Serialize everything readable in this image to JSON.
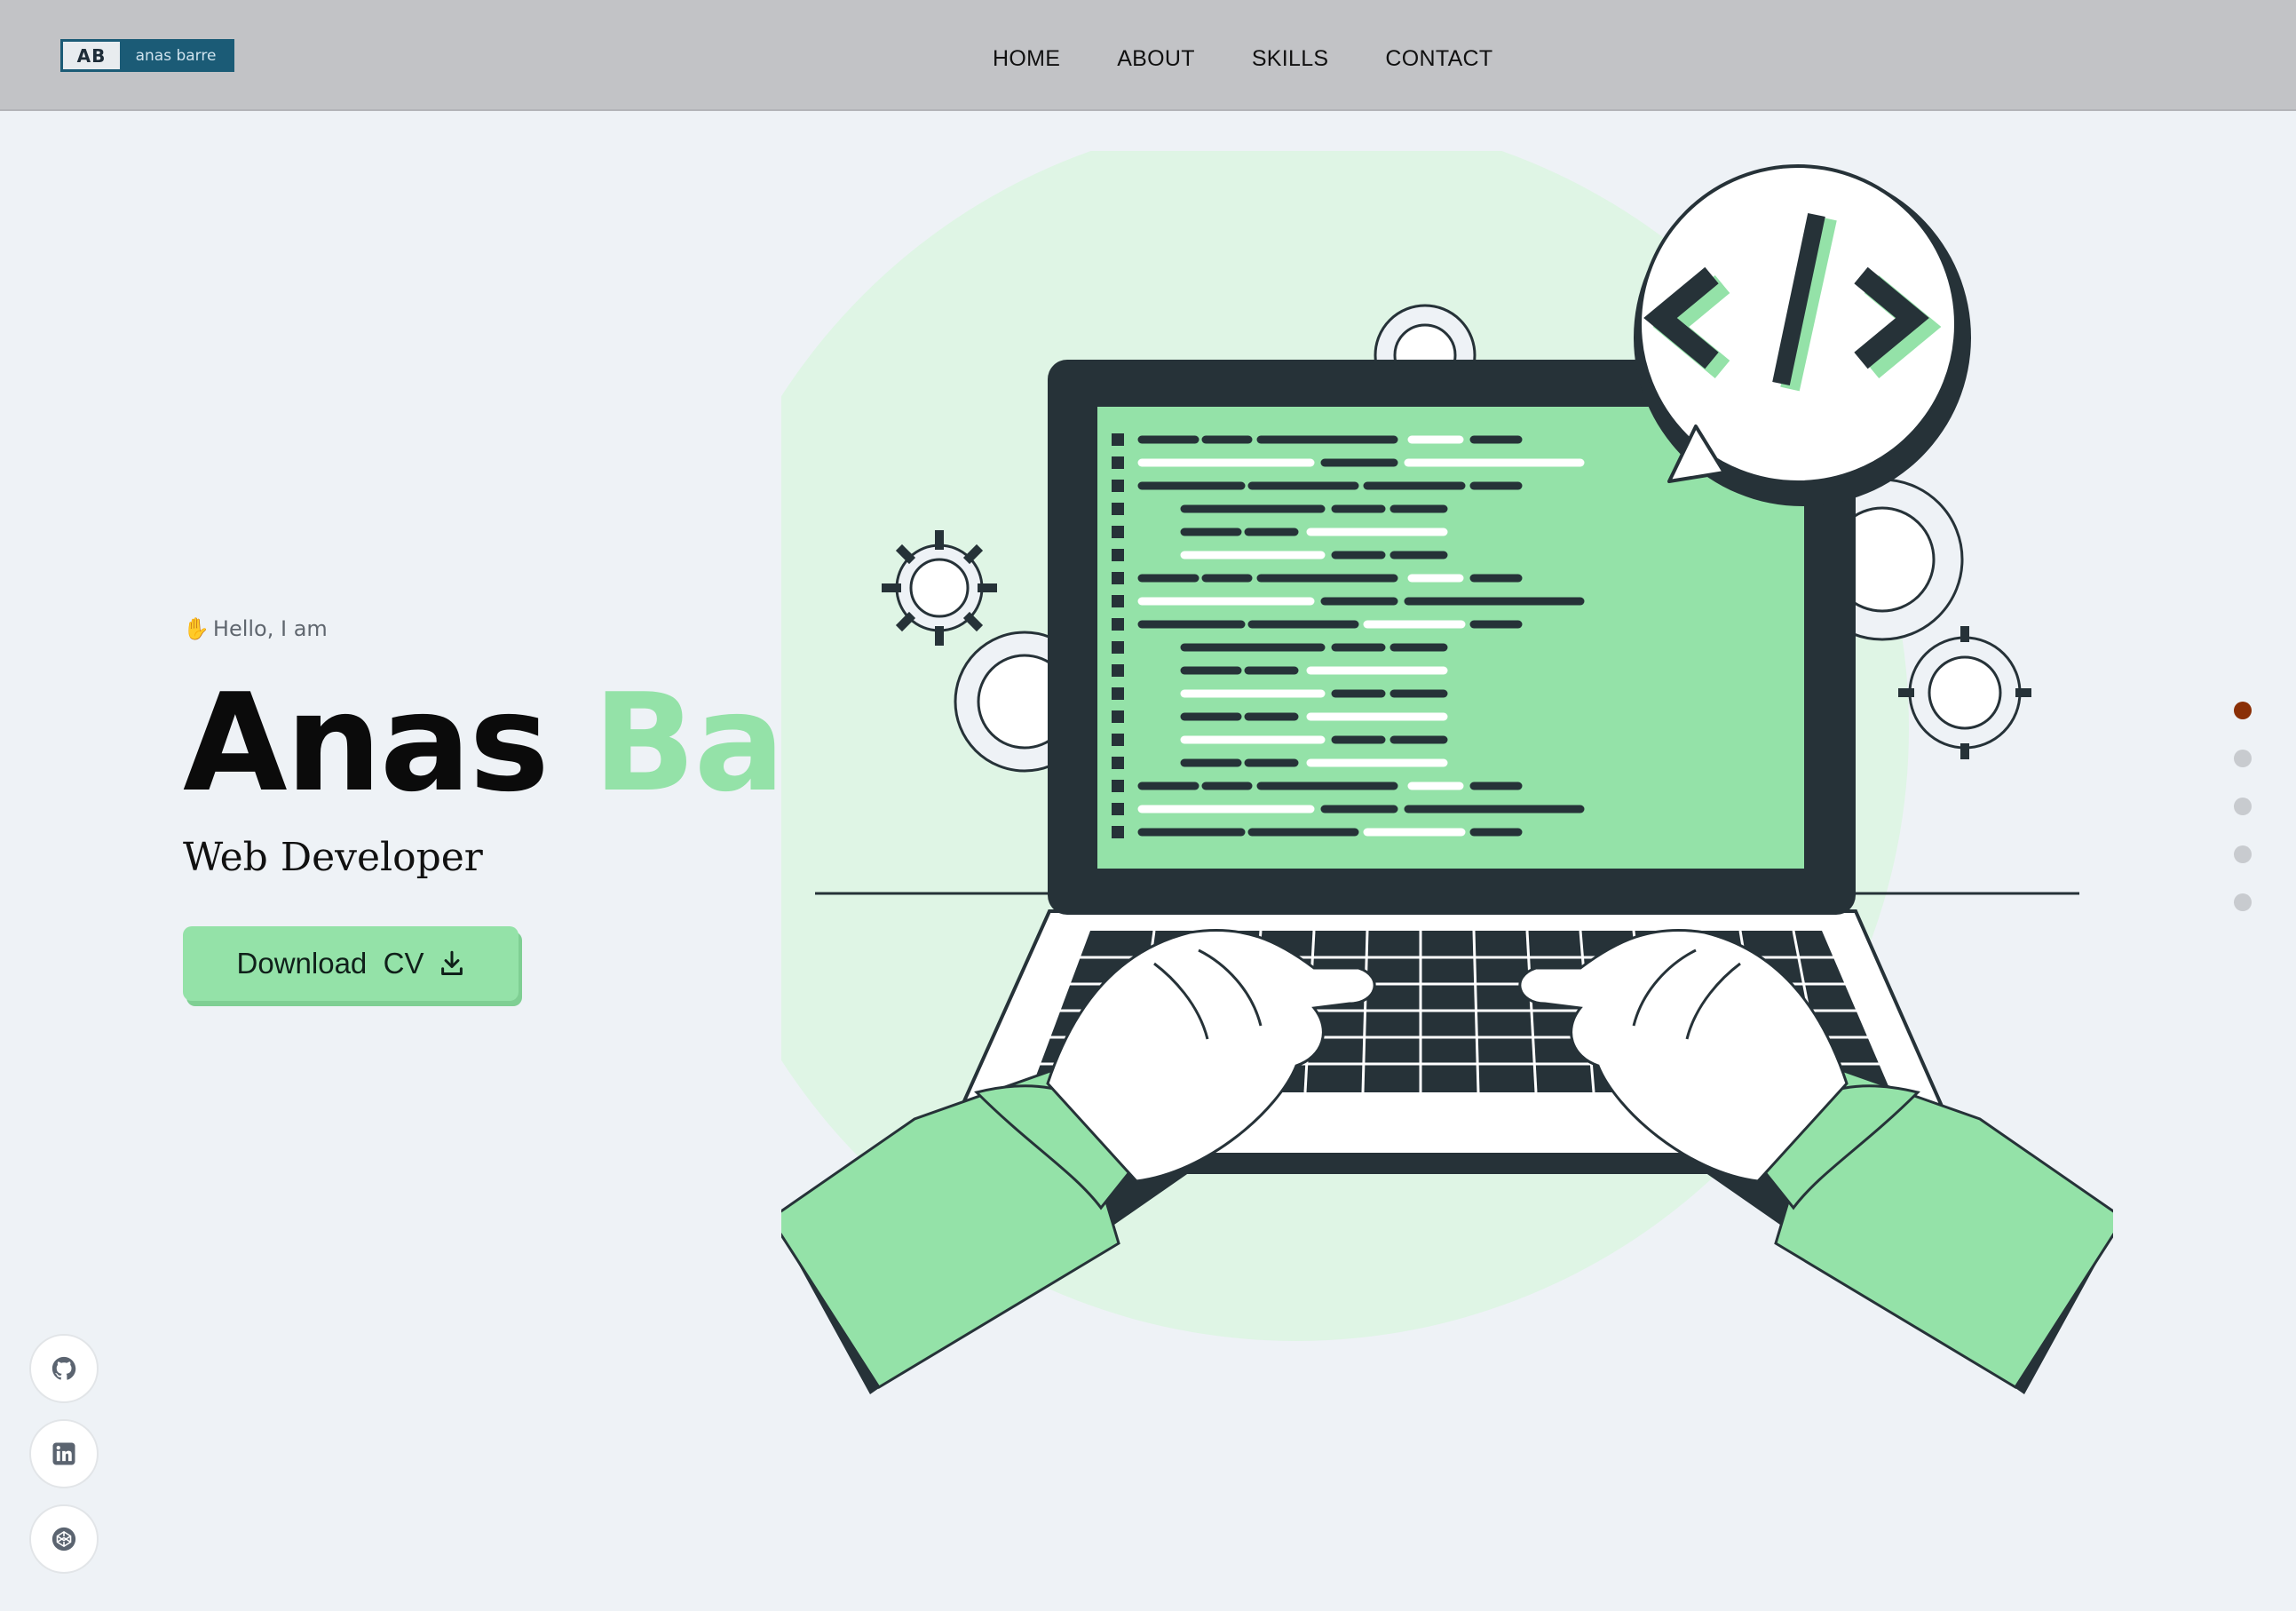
{
  "header": {
    "logo_mark": "AB",
    "logo_text": "anas barre",
    "nav": [
      "HOME",
      "ABOUT",
      "SKILLS",
      "CONTACT"
    ]
  },
  "hero": {
    "wave_icon": "waving-hand-icon",
    "greeting": "Hello, I am",
    "first_name": "Anas",
    "last_name": "Barre",
    "role": "Web Developer",
    "cv_button": "Download  CV",
    "cv_icon": "download-icon"
  },
  "colors": {
    "accent": "#94e2a8",
    "accent_light": "#dff5e5",
    "dark": "#263238",
    "background": "#eef2f6",
    "header": "#c2c3c6",
    "logo": "#1b5b76",
    "active_dot": "#8a2f06"
  },
  "illustration": {
    "code_symbol": "</>"
  },
  "pagination": {
    "total": 5,
    "active_index": 0
  },
  "socials": [
    {
      "icon": "github-icon"
    },
    {
      "icon": "linkedin-icon"
    },
    {
      "icon": "codepen-icon"
    }
  ]
}
